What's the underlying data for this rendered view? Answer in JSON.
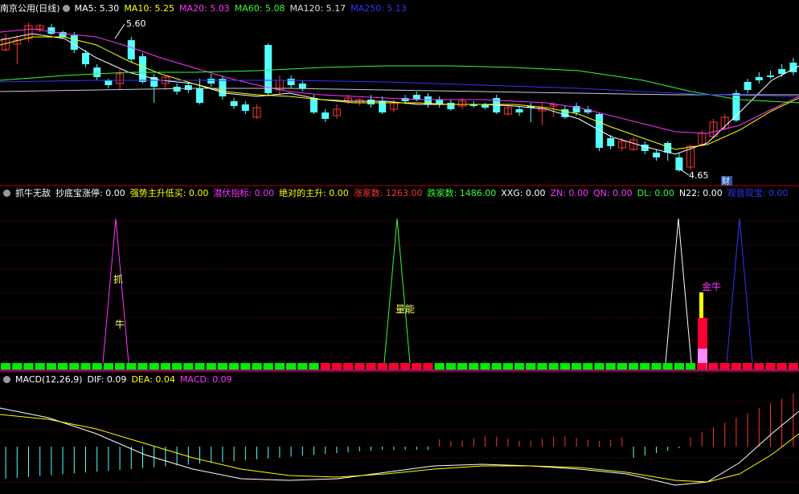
{
  "main_panel": {
    "title": "南京公用(日线)",
    "indicators": [
      {
        "label": "MA5: 5.30",
        "color": "#ffffff"
      },
      {
        "label": "MA10: 5.25",
        "color": "#ffff00"
      },
      {
        "label": "MA20: 5.03",
        "color": "#ff33ff"
      },
      {
        "label": "MA60: 5.08",
        "color": "#33ff33"
      },
      {
        "label": "MA120: 5.17",
        "color": "#dddddd"
      },
      {
        "label": "MA250: 5.13",
        "color": "#3333ff"
      }
    ],
    "high_label": "5.60",
    "low_label": "4.65",
    "event_label": "财"
  },
  "indicator_panel": {
    "title": "抓牛无敌",
    "fields": [
      {
        "label": "抄底宝涨停: 0.00",
        "color": "#ffffff"
      },
      {
        "label": "强势主升低买: 0.00",
        "color": "#ffff00"
      },
      {
        "label": "潜伏指标: 0.00",
        "color": "#ff33ff"
      },
      {
        "label": "绝对的主升: 0.00",
        "color": "#ffff00"
      },
      {
        "label": "涨家数: 1263.00",
        "color": "#ff3333"
      },
      {
        "label": "跌家数: 1486.00",
        "color": "#33ff33"
      },
      {
        "label": "XXG: 0.00",
        "color": "#ffffff"
      },
      {
        "label": "ZN: 0.00",
        "color": "#ff33ff"
      },
      {
        "label": "QN: 0.00",
        "color": "#ff33ff"
      },
      {
        "label": "DL: 0.00",
        "color": "#33ff33"
      },
      {
        "label": "N22: 0.00",
        "color": "#ffffff"
      },
      {
        "label": "观音现宝: 0.00",
        "color": "#3333ff"
      }
    ],
    "signal_texts": {
      "zhua": "抓",
      "niu": "牛",
      "liangneng": "量能",
      "jinniu": "金牛"
    }
  },
  "macd_panel": {
    "title": "MACD(12,26,9)",
    "fields": [
      {
        "label": "DIF: 0.09",
        "color": "#ffffff"
      },
      {
        "label": "DEA: 0.04",
        "color": "#ffff00"
      },
      {
        "label": "MACD: 0.09",
        "color": "#ff33ff"
      }
    ]
  },
  "colors": {
    "up": "#ff3333",
    "down": "#54ffff",
    "ma5": "#ffffff",
    "ma10": "#ffff00",
    "ma20": "#ff33ff",
    "ma60": "#33ff33",
    "ma250": "#3333ff",
    "divider": "#b00000"
  }
}
